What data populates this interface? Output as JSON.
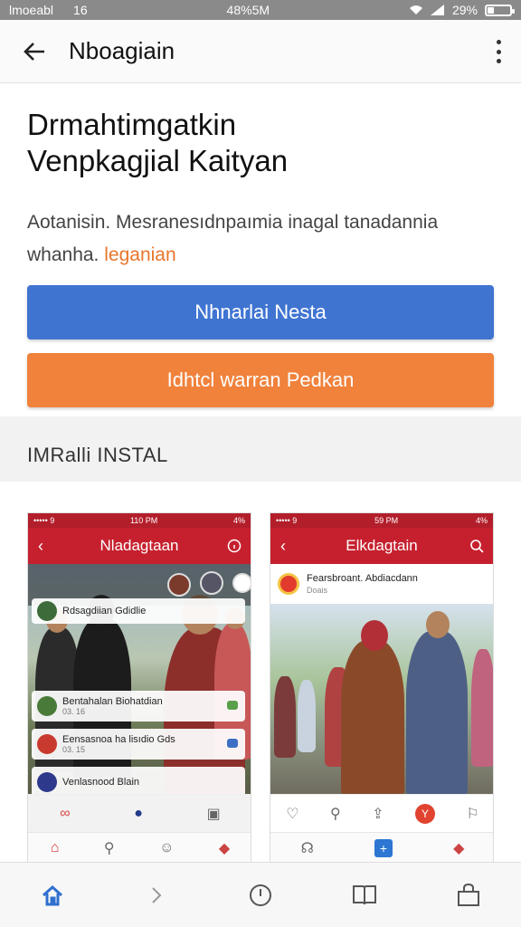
{
  "status_bar": {
    "left_a": "lmoeabl",
    "left_b": "16",
    "center": "48%5M",
    "right": "29%",
    "battery_level": 0.29
  },
  "app_bar": {
    "title": "Nboagiain",
    "back_icon": "arrow-left-icon",
    "more_icon": "more-vert-icon"
  },
  "headline": {
    "line1": "Drmahtimgatkin",
    "line2": "Venpkagjial Kaityan"
  },
  "description": {
    "text": "Aotanisin. Mesranesıdnpaımia inagal tanadannia whanha.",
    "accent": "leganian"
  },
  "buttons": {
    "primary_label": "Nhnarlai Nesta",
    "secondary_label": "Idhtcl  warran Pedkan"
  },
  "section": {
    "title": "IMRalli INSTAL"
  },
  "screens": [
    {
      "status_left": "••••• 9",
      "status_center": "110 PM",
      "status_right": "4%",
      "title": "Nladagtaan",
      "items": [
        {
          "title": "Rdsagdiian Gdidlie",
          "sub": ""
        },
        {
          "title": "Bentahalan Biohatdian",
          "sub": "03. 16"
        },
        {
          "title": "Eensasnoa ha lisıdio Gds",
          "sub": "03. 15"
        },
        {
          "title": "Venlasnood Blain",
          "sub": ""
        }
      ]
    },
    {
      "status_left": "••••• 9",
      "status_center": "59 PM",
      "status_right": "4%",
      "title": "Elkdagtain",
      "post_title": "Fearsbroant. Abdiacdann",
      "post_sub": "Doais"
    }
  ],
  "colors": {
    "primary": "#3f74d1",
    "secondary": "#f0823c",
    "accent_text": "#e8762b",
    "app_red": "#c6202e"
  },
  "bottom_nav": [
    {
      "icon": "home-icon"
    },
    {
      "icon": "chevron-right-icon"
    },
    {
      "icon": "clock-icon"
    },
    {
      "icon": "book-icon"
    },
    {
      "icon": "bag-icon"
    }
  ]
}
